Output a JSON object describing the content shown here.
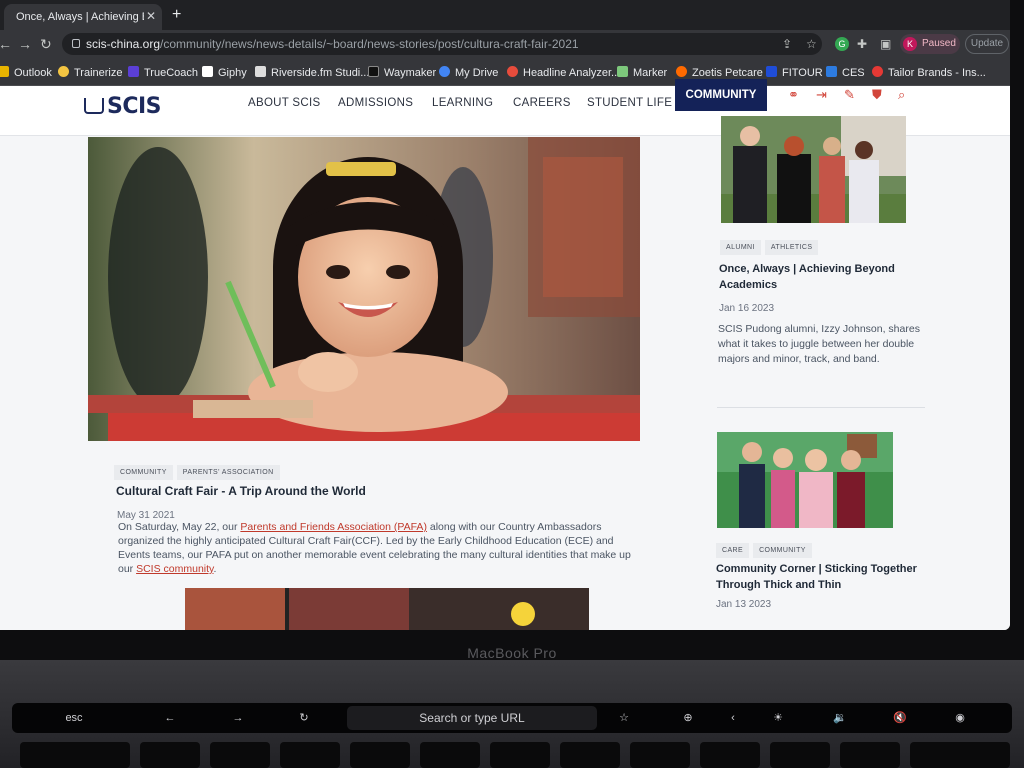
{
  "browser": {
    "tab_title": "Once, Always | Achieving Beyond",
    "tab_close": "✕",
    "new_tab": "+",
    "url_domain": "scis-china.org",
    "url_path": "/community/news/news-details/~board/news-stories/post/cultura-craft-fair-2021",
    "profile_initial": "K",
    "profile_status": "Paused",
    "update_label": "Update",
    "bookmarks": [
      {
        "label": "Outlook",
        "color": "#e8b400"
      },
      {
        "label": "Trainerize",
        "color": "#f4c542"
      },
      {
        "label": "TrueCoach",
        "color": "#5b3fd6"
      },
      {
        "label": "Giphy",
        "color": "#ffffff"
      },
      {
        "label": "Riverside.fm Studi...",
        "color": "#dddddd"
      },
      {
        "label": "Waymaker",
        "color": "#111111"
      },
      {
        "label": "My Drive",
        "color": "#4285f4"
      },
      {
        "label": "Headline Analyzer...",
        "color": "#e74c3c"
      },
      {
        "label": "Marker",
        "color": "#7dc87c"
      },
      {
        "label": "Zoetis Petcare",
        "color": "#ff6a00"
      },
      {
        "label": "FITOUR",
        "color": "#1f4dd8"
      },
      {
        "label": "CES",
        "color": "#2d7be0"
      },
      {
        "label": "Tailor Brands - Ins...",
        "color": "#e53935"
      }
    ]
  },
  "site": {
    "logo": "SCIS",
    "nav": [
      "ABOUT SCIS",
      "ADMISSIONS",
      "LEARNING",
      "CAREERS",
      "STUDENT LIFE",
      "COMMUNITY"
    ],
    "active_nav": "COMMUNITY",
    "accent": "#142258",
    "icon_color": "#d2463b"
  },
  "article": {
    "tags": [
      "COMMUNITY",
      "PARENTS' ASSOCIATION"
    ],
    "title": "Cultural Craft Fair - A Trip Around the World",
    "date": "May 31 2021",
    "body_1": "On Saturday, May 22, our ",
    "link_1": "Parents and Friends Association (PAFA)",
    "body_2": " along with our Country Ambassadors organized the highly anticipated Cultural Craft Fair(CCF). Led by the Early Childhood Education (ECE) and Events teams, our PAFA put on another memorable event celebrating the many cultural identities that make up our ",
    "link_2": "SCIS community",
    "body_3": "."
  },
  "cards": [
    {
      "tags": [
        "ALUMNI",
        "ATHLETICS"
      ],
      "title": "Once, Always | Achieving Beyond Academics",
      "date": "Jan 16 2023",
      "desc": "SCIS Pudong alumni, Izzy Johnson, shares what it takes to juggle between her double majors and minor, track, and band."
    },
    {
      "tags": [
        "CARE",
        "COMMUNITY"
      ],
      "title": "Community Corner | Sticking Together Through Thick and Thin",
      "date": "Jan 13 2023"
    }
  ],
  "laptop": {
    "brand": "MacBook Pro",
    "touchbar_esc": "esc",
    "touchbar_url": "Search or type URL"
  }
}
